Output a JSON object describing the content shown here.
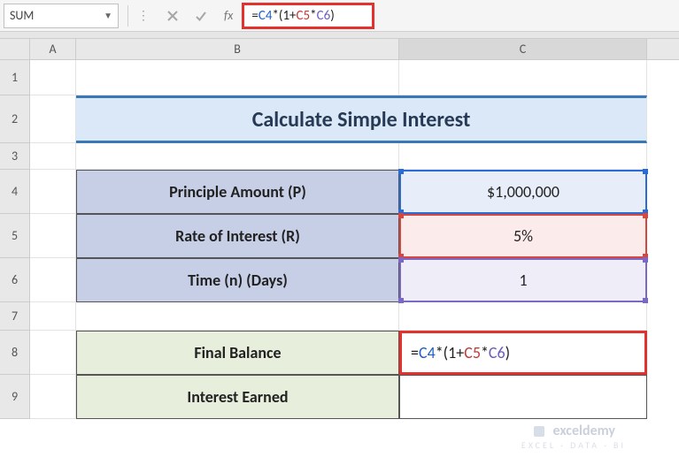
{
  "name_box": {
    "value": "SUM"
  },
  "formula_bar": {
    "formula": "=C4*(1+C5*C6)",
    "parts": {
      "eq": "=",
      "c4": "C4",
      "mul1": "*(1+",
      "c5": "C5",
      "mul2": "*",
      "c6": "C6",
      "close": ")"
    },
    "fx_label": "fx"
  },
  "columns": {
    "A": "A",
    "B": "B",
    "C": "C"
  },
  "rows": {
    "1": "1",
    "2": "2",
    "3": "3",
    "4": "4",
    "5": "5",
    "6": "6",
    "7": "7",
    "8": "8",
    "9": "9"
  },
  "title": "Calculate Simple Interest",
  "table": {
    "principle": {
      "label": "Principle Amount (P)",
      "value": "$1,000,000"
    },
    "rate": {
      "label": "Rate of Interest (R)",
      "value": "5%"
    },
    "time": {
      "label": "Time (n) (Days)",
      "value": "1"
    }
  },
  "results": {
    "final_balance": {
      "label": "Final Balance",
      "display": "=C4*(1+C5*C6)"
    },
    "interest_earned": {
      "label": "Interest Earned",
      "display": ""
    }
  },
  "watermark": {
    "line1": "exceldemy",
    "line2": "EXCEL · DATA · BI"
  }
}
